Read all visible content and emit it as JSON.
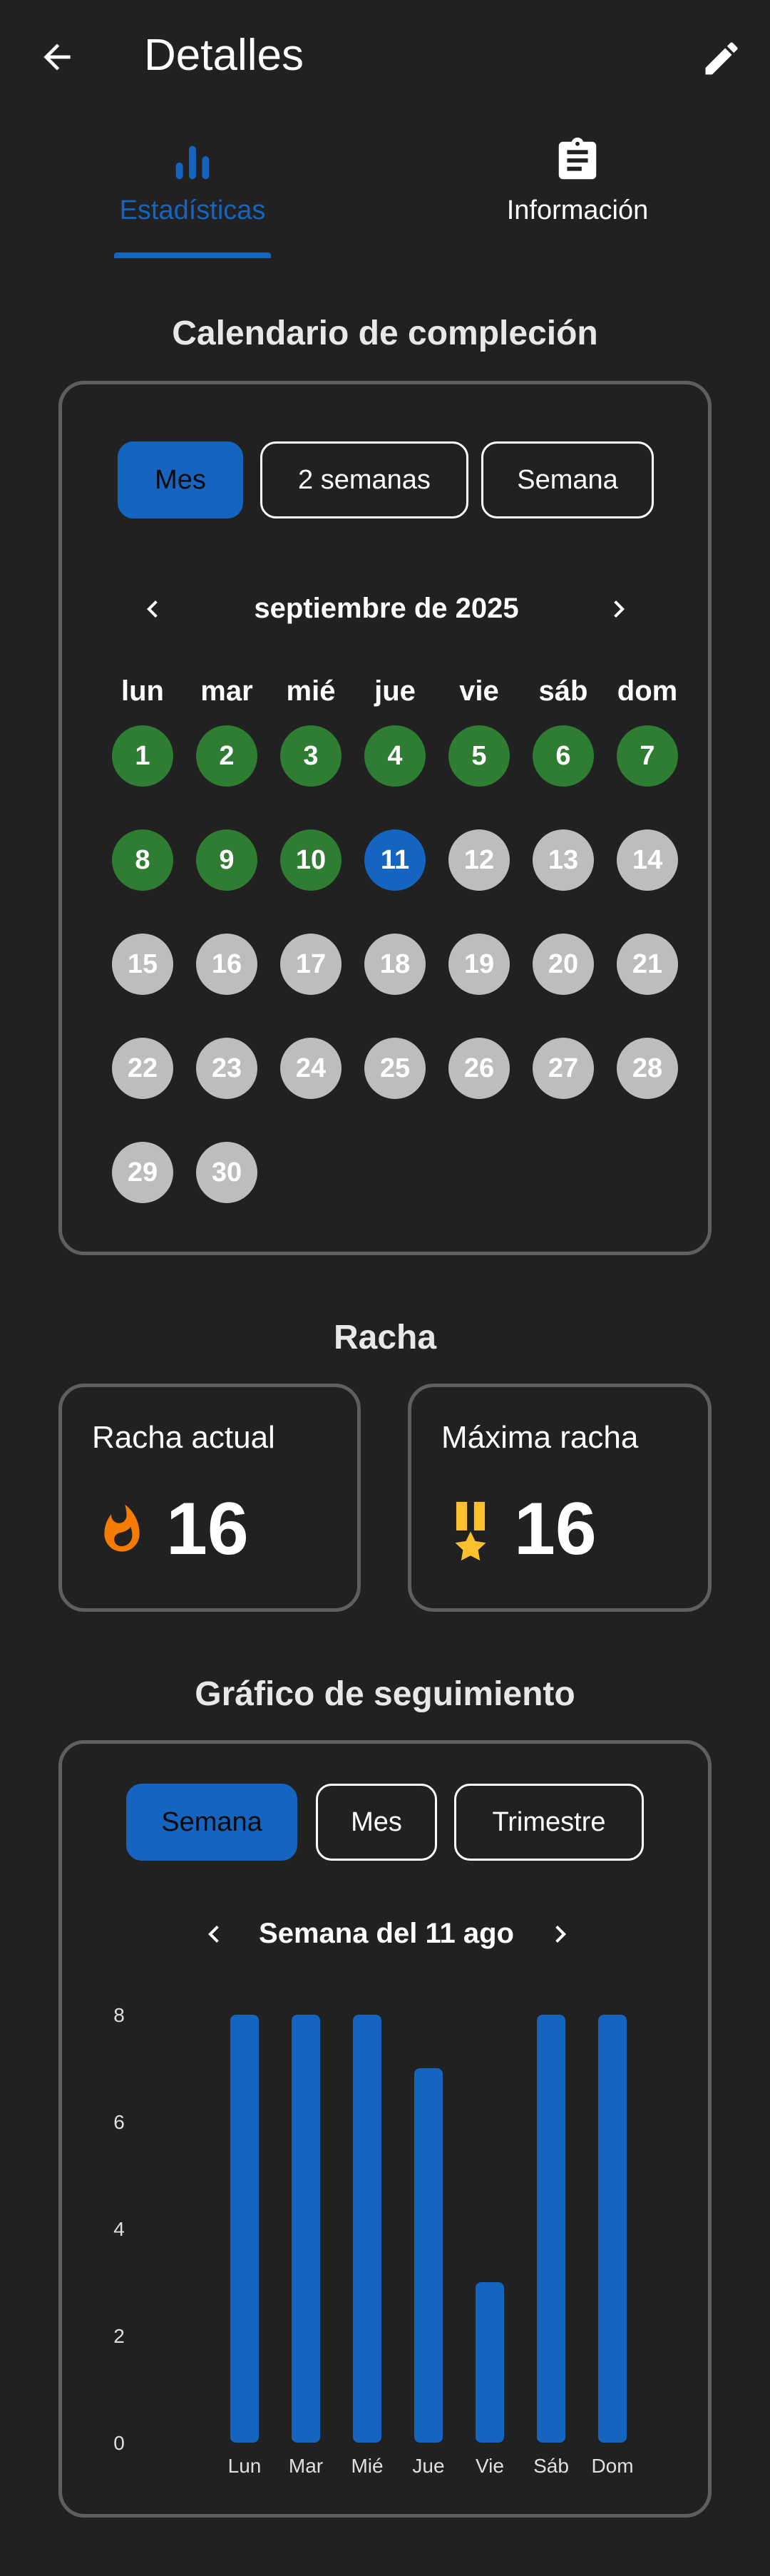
{
  "appbar": {
    "title": "Detalles"
  },
  "tabs": [
    {
      "label": "Estadísticas",
      "icon": "bar-chart-icon",
      "selected": true
    },
    {
      "label": "Información",
      "icon": "clipboard-icon",
      "selected": false
    }
  ],
  "calendar": {
    "title": "Calendario de compleción",
    "ranges": [
      "Mes",
      "2 semanas",
      "Semana"
    ],
    "selected_range": "Mes",
    "month_label": "septiembre de 2025",
    "weekdays": [
      "lun",
      "mar",
      "mié",
      "jue",
      "vie",
      "sáb",
      "dom"
    ],
    "today": 11,
    "days": [
      {
        "n": "1",
        "state": "done"
      },
      {
        "n": "2",
        "state": "done"
      },
      {
        "n": "3",
        "state": "done"
      },
      {
        "n": "4",
        "state": "done"
      },
      {
        "n": "5",
        "state": "done"
      },
      {
        "n": "6",
        "state": "done"
      },
      {
        "n": "7",
        "state": "done"
      },
      {
        "n": "8",
        "state": "done"
      },
      {
        "n": "9",
        "state": "done"
      },
      {
        "n": "10",
        "state": "done"
      },
      {
        "n": "11",
        "state": "today"
      },
      {
        "n": "12",
        "state": "future"
      },
      {
        "n": "13",
        "state": "future"
      },
      {
        "n": "14",
        "state": "future"
      },
      {
        "n": "15",
        "state": "future"
      },
      {
        "n": "16",
        "state": "future"
      },
      {
        "n": "17",
        "state": "future"
      },
      {
        "n": "18",
        "state": "future"
      },
      {
        "n": "19",
        "state": "future"
      },
      {
        "n": "20",
        "state": "future"
      },
      {
        "n": "21",
        "state": "future"
      },
      {
        "n": "22",
        "state": "future"
      },
      {
        "n": "23",
        "state": "future"
      },
      {
        "n": "24",
        "state": "future"
      },
      {
        "n": "25",
        "state": "future"
      },
      {
        "n": "26",
        "state": "future"
      },
      {
        "n": "27",
        "state": "future"
      },
      {
        "n": "28",
        "state": "future"
      },
      {
        "n": "29",
        "state": "future"
      },
      {
        "n": "30",
        "state": "future"
      }
    ]
  },
  "streak": {
    "title": "Racha",
    "current": {
      "label": "Racha actual",
      "value": "16",
      "icon": "fire-icon"
    },
    "max": {
      "label": "Máxima racha",
      "value": "16",
      "icon": "medal-icon"
    }
  },
  "tracking": {
    "title": "Gráfico de seguimiento",
    "ranges": [
      "Semana",
      "Mes",
      "Trimestre"
    ],
    "selected_range": "Semana",
    "period_label": "Semana del 11 ago"
  },
  "colors": {
    "accent": "#1565c0",
    "done": "#2e7d32",
    "future": "#bdbdbd",
    "background": "#212121",
    "card_border": "#5f5f5f",
    "fire": "#f57c00",
    "medal": "#fbc02d"
  },
  "chart_data": {
    "type": "bar",
    "categories": [
      "Lun",
      "Mar",
      "Mié",
      "Jue",
      "Vie",
      "Sáb",
      "Dom"
    ],
    "values": [
      8,
      8,
      8,
      7,
      3,
      8,
      8
    ],
    "yticks": [
      0,
      2,
      4,
      6,
      8
    ],
    "ylim": [
      0,
      8
    ],
    "xlabel": "",
    "ylabel": "",
    "grid": false,
    "legend": "none"
  }
}
